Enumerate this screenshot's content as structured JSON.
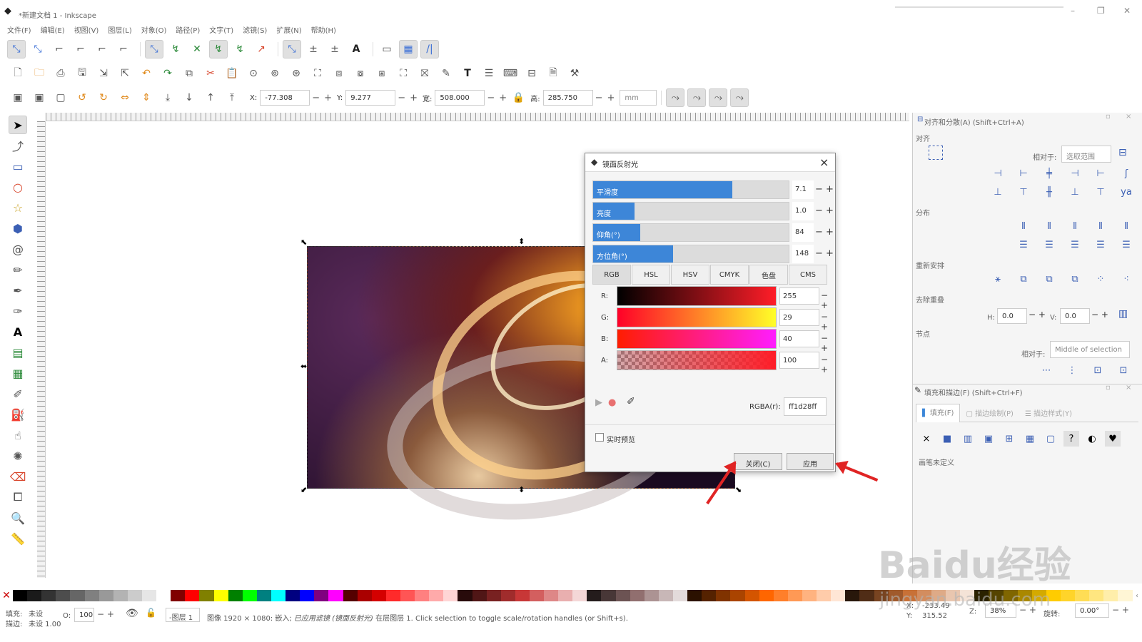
{
  "window": {
    "title": "*新建文档 1 - Inkscape",
    "minimize": "–",
    "maximize": "❐",
    "close": "✕"
  },
  "menu": [
    "文件(F)",
    "编辑(E)",
    "视图(V)",
    "图层(L)",
    "对象(O)",
    "路径(P)",
    "文字(T)",
    "滤镜(S)",
    "扩展(N)",
    "帮助(H)"
  ],
  "toolbar": {
    "x_label": "X:",
    "x": "-77.308",
    "y_label": "Y:",
    "y": "9.277",
    "w_label": "宽:",
    "w": "508.000",
    "h_label": "高:",
    "h": "285.750",
    "unit": "mm"
  },
  "dialog": {
    "title": "镜面反射光",
    "sliders": [
      {
        "label": "平滑度",
        "value": "7.1",
        "fill": 0.71
      },
      {
        "label": "亮度",
        "value": "1.0",
        "fill": 0.21
      },
      {
        "label": "仰角(°)",
        "value": "84",
        "fill": 0.24
      },
      {
        "label": "方位角(°)",
        "value": "148",
        "fill": 0.41
      }
    ],
    "tabs": [
      "RGB",
      "HSL",
      "HSV",
      "CMYK",
      "色盘",
      "CMS"
    ],
    "channels": [
      {
        "label": "R:",
        "value": "255"
      },
      {
        "label": "G:",
        "value": "29"
      },
      {
        "label": "B:",
        "value": "40"
      },
      {
        "label": "A:",
        "value": "100"
      }
    ],
    "rgba_label": "RGBA(r):",
    "rgba": "ff1d28ff",
    "live_preview": "实时预览",
    "close_btn": "关闭(C)",
    "apply_btn": "应用"
  },
  "align_panel": {
    "title": "对齐和分散(A) (Shift+Ctrl+A)",
    "align": "对齐",
    "relative_to": "相对于:",
    "relative_value": "选取范围",
    "distribute": "分布",
    "rearrange": "重新安排",
    "remove_overlap": "去除重叠",
    "h_label": "H:",
    "h_value": "0.0",
    "v_label": "V:",
    "v_value": "0.0",
    "nodes": "节点",
    "nodes_relative_to": "相对于:",
    "nodes_relative_value": "Middle of selection"
  },
  "fill_panel": {
    "title": "填充和描边(F) (Shift+Ctrl+F)",
    "tab_fill": "填充(F)",
    "tab_stroke_paint": "描边绘制(P)",
    "tab_stroke_style": "描边样式(Y)",
    "undefined": "画笔未定义"
  },
  "status": {
    "fill_label": "填充:",
    "fill_value": "未设",
    "stroke_label": "描边:",
    "stroke_value": "未设 1.00",
    "opacity_label": "O:",
    "opacity": "100",
    "layer": "-图层 1",
    "message_pre": "图像 1920 × 1080: 嵌入; ",
    "message_italic": "已应用滤镜 (镜面反射光)",
    "message_post": " 在层图层 1. Click selection to toggle scale/rotation handles (or Shift+s).",
    "x_label": "X:",
    "x": "-233.49",
    "y_label": "Y:",
    "y": "315.52",
    "zoom_label": "Z:",
    "zoom": "38%",
    "rotate_label": "旋转:",
    "rotate": "0.00°"
  },
  "watermark": {
    "brand": "Baidu经验",
    "url": "jingyan.baidu.com"
  }
}
